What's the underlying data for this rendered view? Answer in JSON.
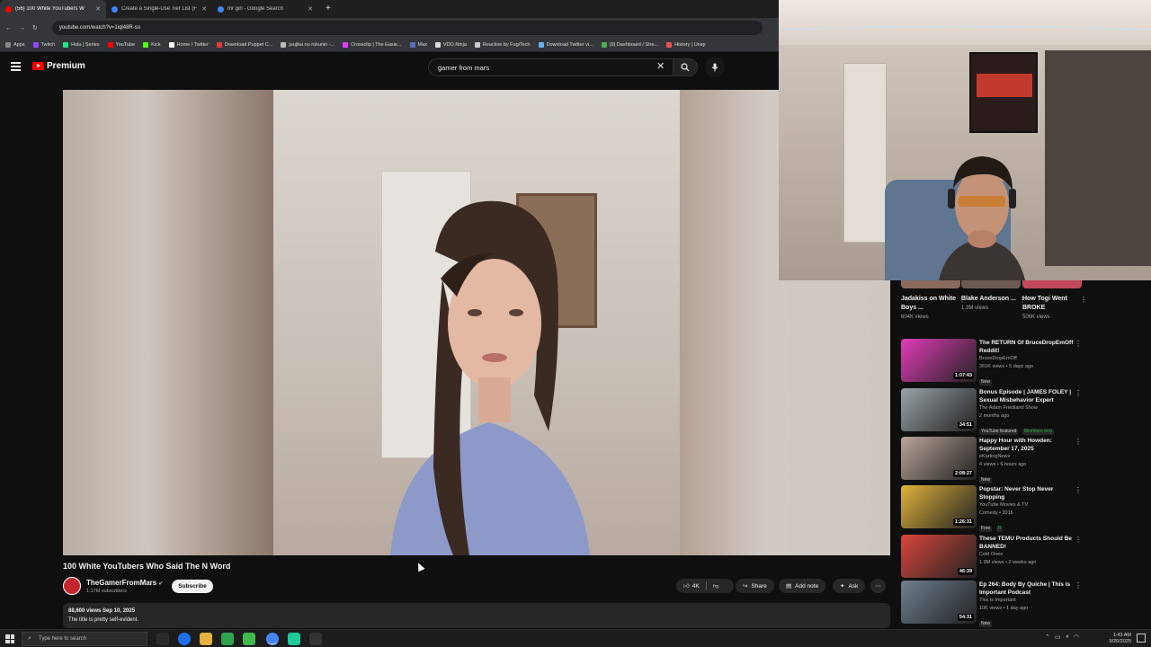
{
  "browser": {
    "tabs": [
      {
        "title": "(56) 100 White YouTubers W",
        "active": true,
        "color": "#ff0000"
      },
      {
        "title": "Create a Single-Use Tier List (F",
        "active": false,
        "color": "#3f83f8"
      },
      {
        "title": "mr girl - Google Search",
        "active": false,
        "color": "#4285f4"
      }
    ],
    "url": "youtube.com/watch?v=1iql48R-so",
    "bookmarks": [
      {
        "label": "Apps",
        "color": "#888888"
      },
      {
        "label": "Twitch",
        "color": "#9146ff"
      },
      {
        "label": "Hulu | Series",
        "color": "#1ce783"
      },
      {
        "label": "YouTube",
        "color": "#ff0000"
      },
      {
        "label": "Kick",
        "color": "#53fc18"
      },
      {
        "label": "Home / Twitter",
        "color": "#ffffff"
      },
      {
        "label": "Download Puppet C...",
        "color": "#e53935"
      },
      {
        "label": "juujika no rokunin -...",
        "color": "#bbbbbb"
      },
      {
        "label": "Crossclip | The Easie...",
        "color": "#e040fb"
      },
      {
        "label": "Max",
        "color": "#5c6bc0"
      },
      {
        "label": "VDO.Ninja",
        "color": "#dddddd"
      },
      {
        "label": "Reactive by FugiTech",
        "color": "#cccccc"
      },
      {
        "label": "Download Twitter vi...",
        "color": "#64b5f6"
      },
      {
        "label": "(9) Dashboard / Stre...",
        "color": "#4caf50"
      },
      {
        "label": "History | Unsp",
        "color": "#ef5350"
      }
    ]
  },
  "youtube": {
    "logo_label": "Premium",
    "search_value": "gamer from mars",
    "video": {
      "title": "100 White YouTubers Who Said The N Word",
      "channel": "TheGamerFromMars",
      "subscribers": "1.17M subscribers",
      "subscribe_label": "Subscribe",
      "likes": "4K",
      "share_label": "Share",
      "add_note_label": "Add note",
      "ask_label": "Ask",
      "views_date": "88,600 views  Sep 10, 2025",
      "description": "The title is pretty self-evident."
    },
    "shorts": [
      {
        "title": "Jadakiss on White Boys ...",
        "views": "604K views",
        "color": "#8a6a5c"
      },
      {
        "title": "Blake Anderson ...",
        "views": "1.3M views",
        "color": "#6b5a52"
      },
      {
        "title": "How Togi Went BROKE",
        "views": "506K views",
        "color": "#c2495a"
      }
    ],
    "recommendations": [
      {
        "title": "The RETURN Of BruceDropEmOff Reddit!",
        "channel": "BruceDropEmOff",
        "meta": "361K views • 5 days ago",
        "badge": "New",
        "duration": "1:07:43",
        "thumb": "#e23bb8"
      },
      {
        "title": "Bonus Episode | JAMES FOLEY | Sexual Misbehavior Expert",
        "channel": "The Adam Friedland Show",
        "meta": "2 months ago",
        "badge": "YouTube featured",
        "badge2": "Members only",
        "duration": "34:51",
        "thumb": "#9aa3a8"
      },
      {
        "title": "Happy Hour with Howden: September 17, 2025",
        "channel": "eKartingNews",
        "meta": "4 views • 6 hours ago",
        "badge": "New",
        "duration": "2:08:27",
        "thumb": "#b9a49a"
      },
      {
        "title": "Popstar: Never Stop Never Stopping",
        "channel": "YouTube Movies & TV",
        "meta": "Comedy • 2016",
        "badge": "Free",
        "badge2": "R",
        "duration": "1:26:31",
        "thumb": "#e0b23a"
      },
      {
        "title": "These TEMU Products Should Be BANNED!",
        "channel": "Cold Ones",
        "meta": "1.9M views • 2 weeks ago",
        "badge": "",
        "duration": "46:39",
        "thumb": "#d9463c"
      },
      {
        "title": "Ep 264: Body By Quiche | This is Important Podcast",
        "channel": "This is Important",
        "meta": "10K views • 1 day ago",
        "badge": "New",
        "duration": "54:31",
        "thumb": "#6f7f8f"
      }
    ]
  },
  "taskbar": {
    "search_placeholder": "Type here to search",
    "time": "1:43 AM",
    "date": "9/20/2025"
  }
}
